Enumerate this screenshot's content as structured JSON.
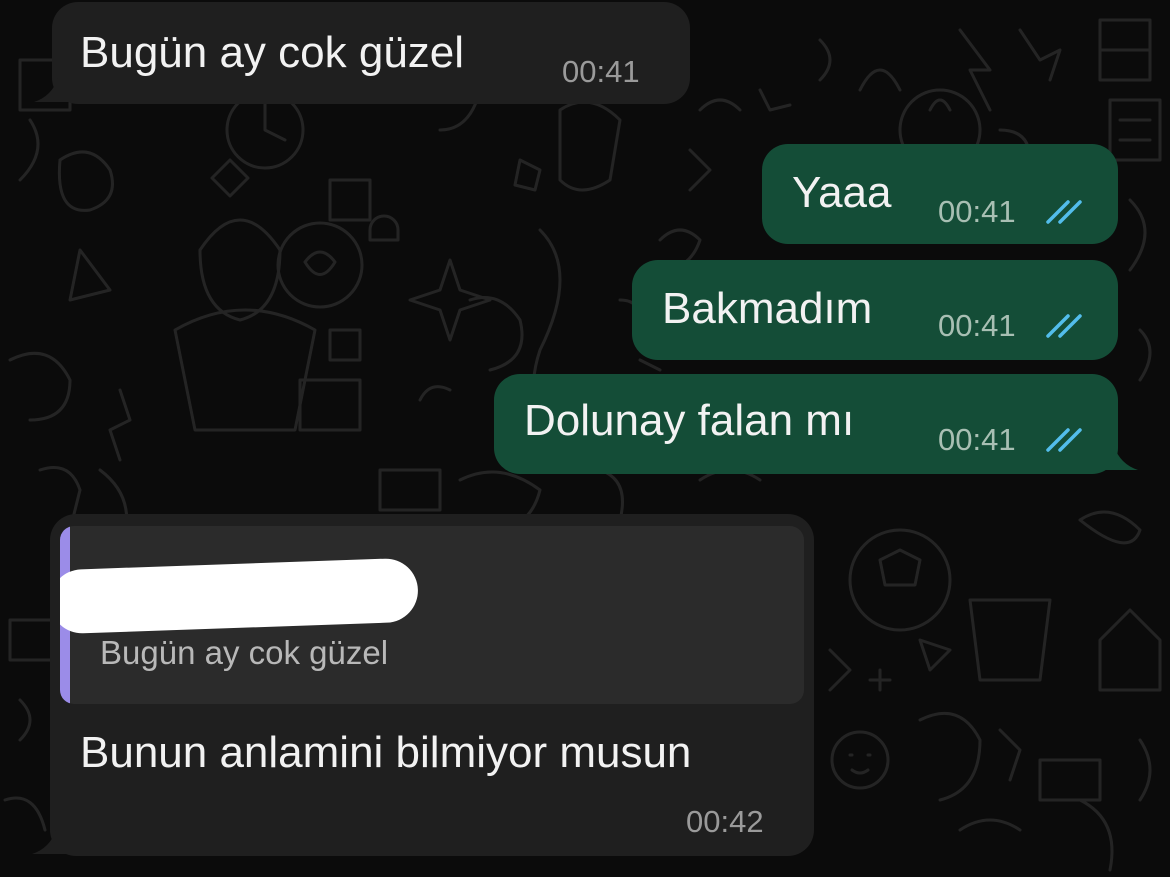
{
  "colors": {
    "background": "#0b0b0b",
    "incoming_bubble": "#1f1f1f",
    "outgoing_bubble": "#144d37",
    "read_ticks": "#53bdeb",
    "quote_accent": "#9b8ce8"
  },
  "messages": [
    {
      "direction": "incoming",
      "text": "Bugün ay cok güzel",
      "time": "00:41"
    },
    {
      "direction": "outgoing",
      "text": "Yaaa",
      "time": "00:41",
      "status_icon": "double-check-read-icon"
    },
    {
      "direction": "outgoing",
      "text": "Bakmadım",
      "time": "00:41",
      "status_icon": "double-check-read-icon"
    },
    {
      "direction": "outgoing",
      "text": "Dolunay falan mı",
      "time": "00:41",
      "status_icon": "double-check-read-icon"
    },
    {
      "direction": "incoming",
      "text": "Bunun anlamini bilmiyor musun",
      "time": "00:42",
      "reply_to": {
        "author_redacted": true,
        "text": "Bugün ay cok güzel"
      }
    }
  ]
}
